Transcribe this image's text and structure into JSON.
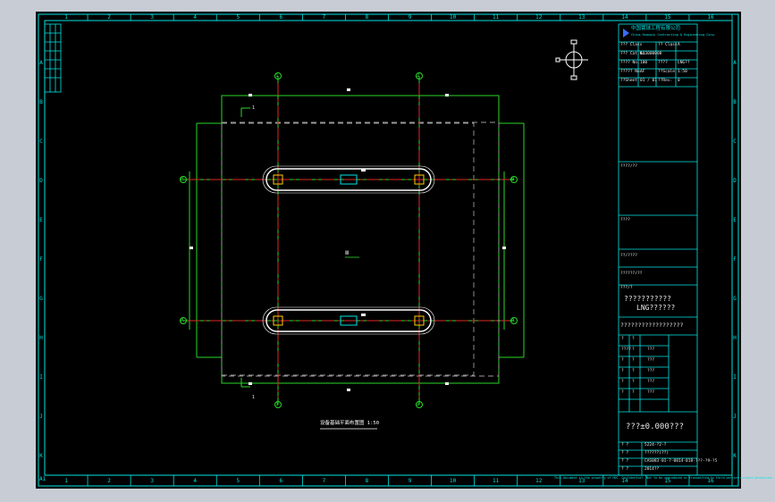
{
  "frame": {
    "columns": [
      "1",
      "2",
      "3",
      "4",
      "5",
      "6",
      "7",
      "8",
      "9",
      "10",
      "11",
      "12",
      "13",
      "14",
      "15",
      "16"
    ],
    "rows": [
      "A",
      "B",
      "C",
      "D",
      "E",
      "F",
      "G",
      "H",
      "I",
      "J",
      "K"
    ],
    "corner_label": "A1"
  },
  "drawing": {
    "axis_numbers": [
      "1",
      "2"
    ],
    "axis_letters": [
      "B",
      "A"
    ],
    "center_tag": "Ⅲ",
    "section_tag": "1",
    "caption": "设备基础平面布置图 1:50"
  },
  "title_block": {
    "company_cn": "中国寰球工程有限公司",
    "company_en": "China Huanqiu Contracting & Engineering Corp.",
    "rows": [
      {
        "k1": "??? Class",
        "v1": "",
        "k2": "?? Class",
        "v2": "A"
      },
      {
        "k1": "??? Cat No.",
        "v1": "A13000008",
        "k2": "",
        "v2": ""
      },
      {
        "k1": "???? No.",
        "v1": "100",
        "k2": "????",
        "v2": "LNG??"
      },
      {
        "k1": "????? No.",
        "v1": "AF",
        "k2": "??Scale",
        "v2": "1:50"
      },
      {
        "k1": "??Sheet",
        "v1": "01 / 01",
        "k2": "??Rev.",
        "v2": "0"
      }
    ],
    "client_label": "????/??",
    "project_label": "????",
    "unit_label": "??/????",
    "subunit_label": "??????/??",
    "design_label": "???/?",
    "drawing_title_1": "???????????",
    "drawing_title_2": "LNG??????",
    "drawing_title_3": "??????????????????",
    "sign_rows": [
      {
        "a": "?",
        "b": "?",
        "c": "",
        "d": ""
      },
      {
        "a": "????",
        "b": "?",
        "c": "???",
        "d": ""
      },
      {
        "a": "?",
        "b": "?",
        "c": "???",
        "d": ""
      },
      {
        "a": "?",
        "b": "?",
        "c": "???",
        "d": ""
      },
      {
        "a": "?",
        "b": "?",
        "c": "???",
        "d": ""
      },
      {
        "a": "?",
        "b": "?",
        "c": "???",
        "d": ""
      }
    ],
    "elevation": "???±0.000???",
    "doc_rows": [
      {
        "k": "?  ?",
        "v": "5224-?2-?"
      },
      {
        "k": "?  ?",
        "v": "??????(??)"
      },
      {
        "k": "?  ?",
        "v": "CAS083-01-?-0014-018-???-?9-?5"
      },
      {
        "k": "?  ?",
        "v": "2014??"
      }
    ],
    "footer_note": "This document is the property of HQC. Confidential. Not to be reproduced or transmitted to third parties without permission."
  },
  "colors": {
    "sheet": "#000000",
    "border": "#00e5e5",
    "centerline": "#e02828",
    "outline": "#28d828",
    "foundation": "#ffffff",
    "anchor": "#ffd000",
    "hidden": "#9a9a9a"
  }
}
